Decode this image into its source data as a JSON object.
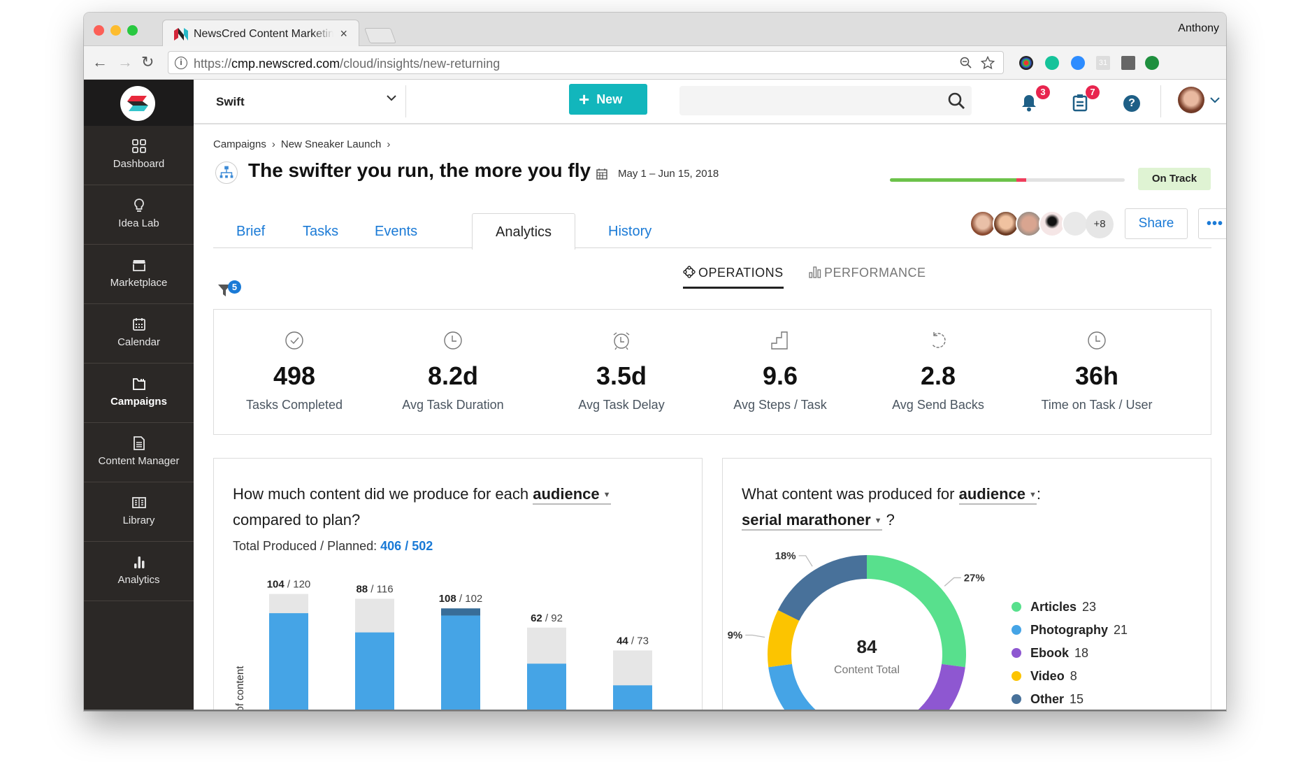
{
  "browser": {
    "tab_title": "NewsCred Content Marketing Platform",
    "tab_close": "×",
    "profile_name": "Anthony",
    "url_prefix": "https://",
    "url_host": "cmp.newscred.com",
    "url_path": "/cloud/insights/new-returning",
    "nav": {
      "back": "←",
      "forward": "→",
      "reload": "↻"
    }
  },
  "header": {
    "workspace": "Swift",
    "new_button": "New",
    "new_plus": "+",
    "search_placeholder": "",
    "notifications_count": "3",
    "tasks_count": "7",
    "help": "?"
  },
  "sidebar": {
    "items": [
      {
        "label": "Dashboard",
        "icon": "grid-icon"
      },
      {
        "label": "Idea Lab",
        "icon": "lightbulb-icon"
      },
      {
        "label": "Marketplace",
        "icon": "store-icon"
      },
      {
        "label": "Calendar",
        "icon": "calendar-icon"
      },
      {
        "label": "Campaigns",
        "icon": "folder-icon",
        "active": true
      },
      {
        "label": "Content Manager",
        "icon": "document-icon"
      },
      {
        "label": "Library",
        "icon": "book-icon"
      },
      {
        "label": "Analytics",
        "icon": "bar-chart-icon"
      }
    ]
  },
  "page": {
    "breadcrumbs": [
      "Campaigns",
      "New Sneaker Launch"
    ],
    "breadcrumb_sep": "›",
    "title": "The swifter you run, the more you fly",
    "date_range": "May 1 – Jun 15, 2018",
    "progress": {
      "complete_fraction": 0.54,
      "overdue_fraction": 0.04,
      "color_complete": "#6cc24a",
      "color_overdue": "#ef3e5c"
    },
    "status": "On Track",
    "tabs": [
      "Brief",
      "Tasks",
      "Events",
      "Analytics",
      "History"
    ],
    "active_tab": "Analytics",
    "extra_members": "+8",
    "share": "Share",
    "more": "•••",
    "subtabs": [
      {
        "label": "OPERATIONS",
        "active": true
      },
      {
        "label": "PERFORMANCE",
        "active": false
      }
    ],
    "filter_count": "5"
  },
  "kpis": [
    {
      "value": "498",
      "label": "Tasks Completed",
      "icon": "check-circle-icon"
    },
    {
      "value": "8.2d",
      "label": "Avg Task Duration",
      "icon": "clock-icon"
    },
    {
      "value": "3.5d",
      "label": "Avg Task Delay",
      "icon": "alarm-clock-icon"
    },
    {
      "value": "9.6",
      "label": "Avg Steps / Task",
      "icon": "stairs-icon"
    },
    {
      "value": "2.8",
      "label": "Avg Send Backs",
      "icon": "undo-icon"
    },
    {
      "value": "36h",
      "label": "Time on Task / User",
      "icon": "clock-icon"
    }
  ],
  "bar_card": {
    "question_pre": "How much content did we produce for each",
    "dimension": "audience",
    "question_post": "compared to plan?",
    "totals_label": "Total Produced / Planned:",
    "totals_value": "406 / 502"
  },
  "donut_card": {
    "question_pre": "What content was produced for",
    "dimension": "audience",
    "colon": ":",
    "value": "serial marathoner",
    "question_mark": "?",
    "center_value": "84",
    "center_label": "Content Total"
  },
  "chart_data": [
    {
      "type": "bar",
      "title": "How much content did we produce for each audience compared to plan?",
      "ylabel": "# of content",
      "xlabel": "",
      "categories": [
        "",
        "",
        "",
        "",
        ""
      ],
      "series": [
        {
          "name": "Produced",
          "values": [
            104,
            88,
            108,
            62,
            44
          ],
          "color": "#45a4e6"
        },
        {
          "name": "Planned",
          "values": [
            120,
            116,
            102,
            92,
            73
          ],
          "color": "#e6e6e6"
        }
      ],
      "overflow_color": "#386d98",
      "data_labels": [
        "104 / 120",
        "88 / 116",
        "108 / 102",
        "62 / 92",
        "44 / 73"
      ],
      "ylim": [
        0,
        130
      ]
    },
    {
      "type": "pie",
      "title": "What content was produced for audience: serial marathoner?",
      "donut": true,
      "total": 84,
      "slices": [
        {
          "label": "Articles",
          "value": 23,
          "pct_label": "27%",
          "color": "#58e08d"
        },
        {
          "label": "Ebook",
          "value": 18,
          "pct_label": "",
          "color": "#8e57d1"
        },
        {
          "label": "Photography",
          "value": 21,
          "pct_label": "",
          "color": "#45a4e6"
        },
        {
          "label": "Video",
          "value": 8,
          "pct_label": "9%",
          "color": "#fcc400"
        },
        {
          "label": "Other",
          "value": 15,
          "pct_label": "18%",
          "color": "#48719a"
        }
      ],
      "legend": [
        {
          "label": "Articles",
          "value": "23",
          "color": "#58e08d"
        },
        {
          "label": "Photography",
          "value": "21",
          "color": "#45a4e6"
        },
        {
          "label": "Ebook",
          "value": "18",
          "color": "#8e57d1"
        },
        {
          "label": "Video",
          "value": "8",
          "color": "#fcc400"
        },
        {
          "label": "Other",
          "value": "15",
          "color": "#48719a"
        }
      ],
      "legend_position": "right"
    }
  ]
}
